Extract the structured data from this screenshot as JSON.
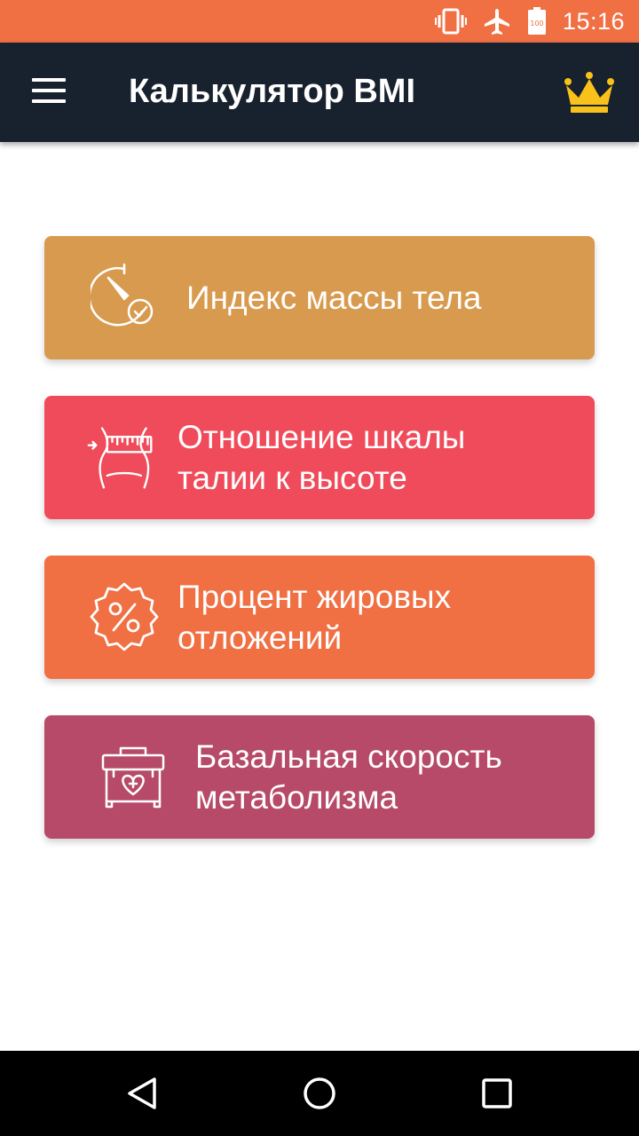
{
  "status_bar": {
    "time": "15:16",
    "battery_text": "100",
    "icons": [
      "vibrate-icon",
      "airplane-icon",
      "battery-icon"
    ],
    "background": "#F07044"
  },
  "app_bar": {
    "title": "Калькулятор BMI",
    "menu_icon": "hamburger-menu-icon",
    "premium_icon": "crown-icon",
    "background": "#18222E"
  },
  "menu": {
    "items": [
      {
        "label": "Индекс массы тела",
        "icon": "stopwatch-check-icon",
        "color": "#D89A4E"
      },
      {
        "label": "Отношение шкалы талии к высоте",
        "icon": "waist-tape-icon",
        "color": "#F04B5A"
      },
      {
        "label": "Процент жировых отложений",
        "icon": "percent-badge-icon",
        "color": "#F07044"
      },
      {
        "label": "Базальная скорость метаболизма",
        "icon": "medical-kit-icon",
        "color": "#B64A68"
      }
    ]
  },
  "nav_bar": {
    "buttons": [
      "back-icon",
      "home-icon",
      "recents-icon"
    ]
  }
}
